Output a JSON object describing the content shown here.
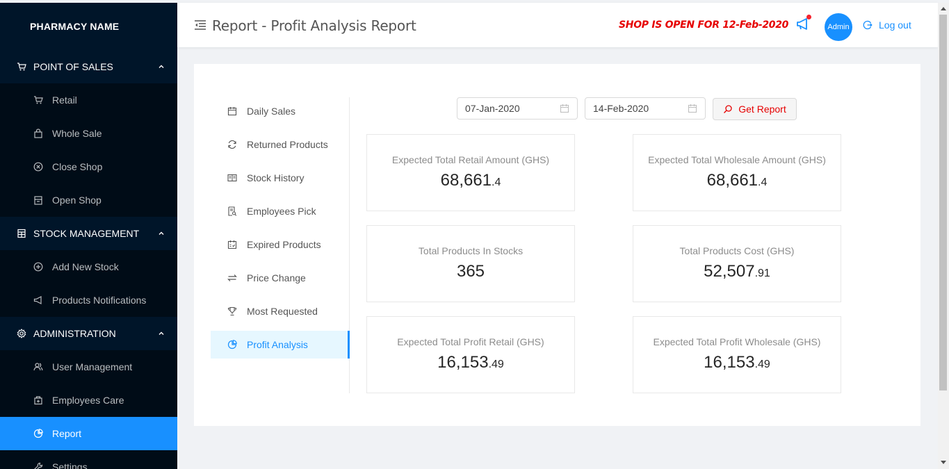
{
  "sidebar": {
    "brand": "PHARMACY NAME",
    "groups": [
      {
        "label": "POINT OF SALES",
        "icon": "cart-icon",
        "items": [
          {
            "label": "Retail",
            "icon": "cart-icon"
          },
          {
            "label": "Whole Sale",
            "icon": "shopping-bag-icon"
          },
          {
            "label": "Close Shop",
            "icon": "close-circle-icon"
          },
          {
            "label": "Open Shop",
            "icon": "shop-icon"
          }
        ]
      },
      {
        "label": "STOCK MANAGEMENT",
        "icon": "calculator-icon",
        "items": [
          {
            "label": "Add New Stock",
            "icon": "plus-circle-icon"
          },
          {
            "label": "Products Notifications",
            "icon": "sound-icon"
          }
        ]
      },
      {
        "label": "ADMINISTRATION",
        "icon": "setting-icon",
        "items": [
          {
            "label": "User Management",
            "icon": "usergroup-icon"
          },
          {
            "label": "Employees Care",
            "icon": "medicine-box-icon"
          },
          {
            "label": "Report",
            "icon": "pie-chart-icon",
            "active": true
          },
          {
            "label": "Settings",
            "icon": "tool-icon"
          }
        ]
      }
    ]
  },
  "header": {
    "title": "Report - Profit Analysis Report",
    "shop_status": "SHOP IS OPEN FOR 12-Feb-2020",
    "avatar": "Admin",
    "logout": "Log out"
  },
  "report_menu": [
    {
      "label": "Daily Sales",
      "icon": "calendar-icon"
    },
    {
      "label": "Returned Products",
      "icon": "sync-icon"
    },
    {
      "label": "Stock History",
      "icon": "read-icon"
    },
    {
      "label": "Employees Pick",
      "icon": "file-search-icon"
    },
    {
      "label": "Expired Products",
      "icon": "schedule-icon"
    },
    {
      "label": "Price Change",
      "icon": "swap-icon"
    },
    {
      "label": "Most Requested",
      "icon": "trophy-icon"
    },
    {
      "label": "Profit Analysis",
      "icon": "pie-chart-icon",
      "active": true
    }
  ],
  "filters": {
    "start_date": "07-Jan-2020",
    "end_date": "14-Feb-2020",
    "get_report": "Get Report"
  },
  "stats": [
    {
      "label": "Expected Total Retail Amount (GHS)",
      "int": "68,661",
      "dec": ".4"
    },
    {
      "label": "Expected Total Wholesale Amount (GHS)",
      "int": "68,661",
      "dec": ".4"
    },
    {
      "label": "Total Products In Stocks",
      "int": "365",
      "dec": ""
    },
    {
      "label": "Total Products Cost (GHS)",
      "int": "52,507",
      "dec": ".91"
    },
    {
      "label": "Expected Total Profit Retail (GHS)",
      "int": "16,153",
      "dec": ".49"
    },
    {
      "label": "Expected Total Profit Wholesale (GHS)",
      "int": "16,153",
      "dec": ".49"
    }
  ]
}
